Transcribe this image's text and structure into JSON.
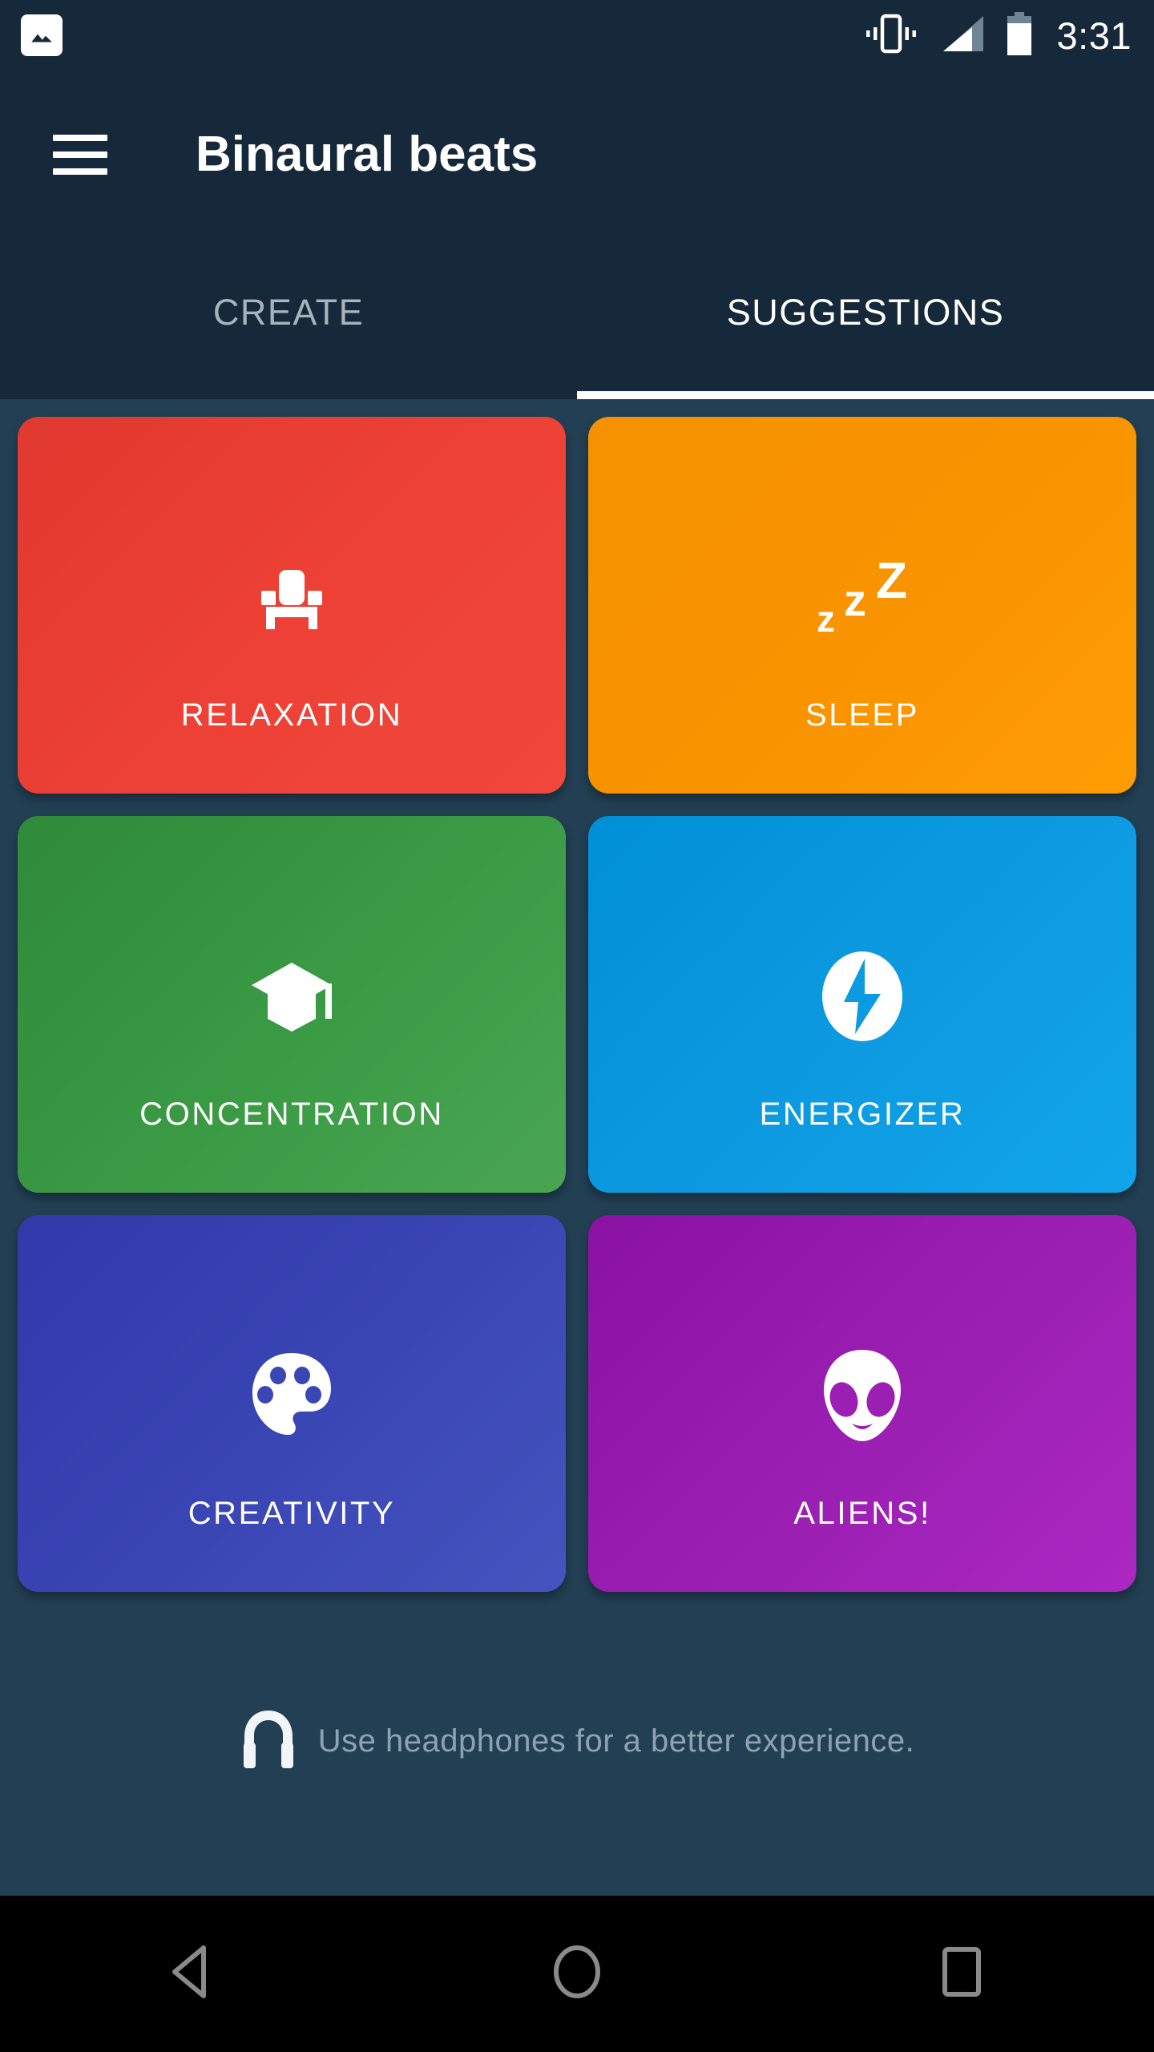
{
  "statusbar": {
    "time": "3:31",
    "icons": [
      "image-notification-icon",
      "vibrate-icon",
      "signal-icon",
      "battery-icon"
    ]
  },
  "appbar": {
    "menu_icon": "hamburger-menu-icon",
    "title": "Binaural beats"
  },
  "tabs": {
    "items": [
      {
        "label": "CREATE",
        "active": false
      },
      {
        "label": "SUGGESTIONS",
        "active": true
      }
    ],
    "active_index": 1,
    "indicator_color": "#ffffff",
    "inactive_color": "#a7b4bd",
    "active_color": "#ffffff"
  },
  "suggestions": {
    "cards": [
      {
        "label": "RELAXATION",
        "icon": "armchair-icon",
        "color": "#ee4136"
      },
      {
        "label": "SLEEP",
        "icon": "zzz-sleep-icon",
        "color": "#fa9300"
      },
      {
        "label": "CONCENTRATION",
        "icon": "graduation-cap-icon",
        "color": "#3b9b45"
      },
      {
        "label": "ENERGIZER",
        "icon": "lightning-bolt-icon",
        "color": "#0d9ae0"
      },
      {
        "label": "CREATIVITY",
        "icon": "paint-palette-icon",
        "color": "#3a46b4"
      },
      {
        "label": "ALIENS!",
        "icon": "alien-head-icon",
        "color": "#9b1fb3"
      }
    ]
  },
  "footer": {
    "icon": "headphones-icon",
    "text": "Use headphones for a better experience."
  },
  "navbar": {
    "buttons": [
      {
        "name": "back-button",
        "icon": "triangle-back-icon"
      },
      {
        "name": "home-button",
        "icon": "circle-home-icon"
      },
      {
        "name": "recents-button",
        "icon": "square-recents-icon"
      }
    ]
  },
  "theme": {
    "appbar_bg": "#16293a",
    "content_bg": "#223f53",
    "navbar_bg": "#000000"
  }
}
